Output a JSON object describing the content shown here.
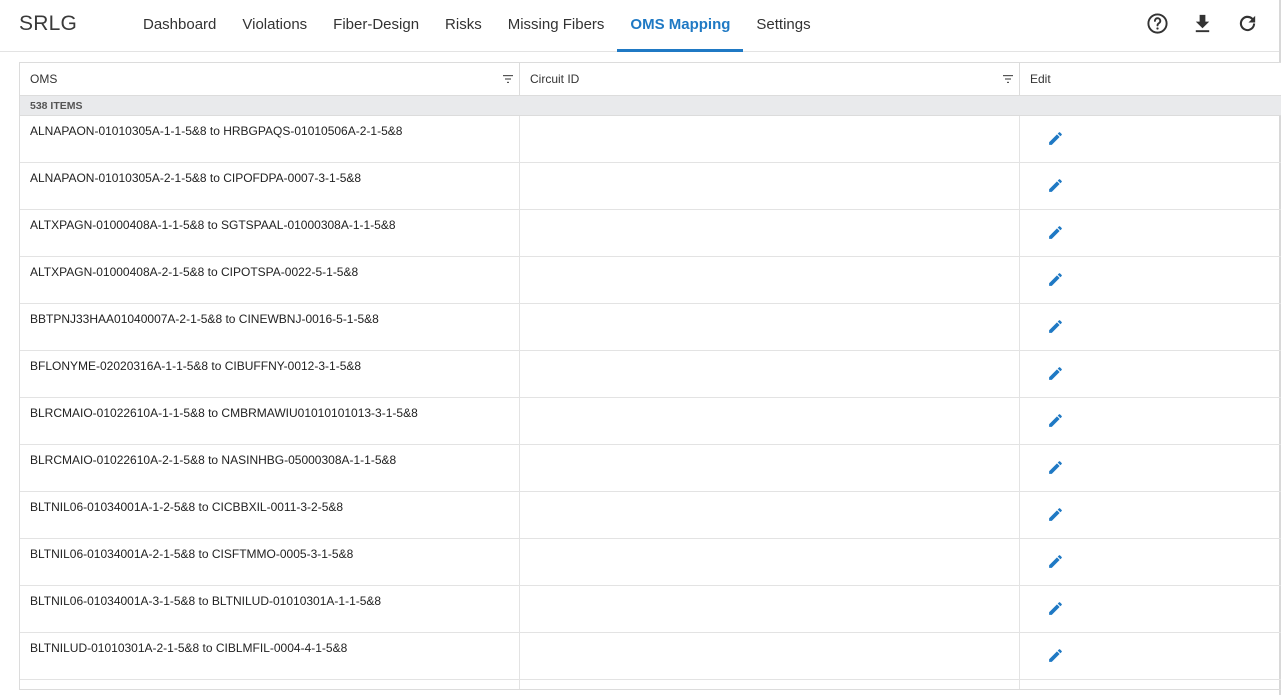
{
  "app": {
    "title": "SRLG"
  },
  "nav": {
    "tabs": [
      {
        "label": "Dashboard"
      },
      {
        "label": "Violations"
      },
      {
        "label": "Fiber-Design"
      },
      {
        "label": "Risks"
      },
      {
        "label": "Missing Fibers"
      },
      {
        "label": "OMS Mapping",
        "active": true
      },
      {
        "label": "Settings"
      }
    ]
  },
  "toolbar": {
    "icons": [
      "help-icon",
      "download-icon",
      "refresh-icon"
    ]
  },
  "grid": {
    "columns": [
      "OMS",
      "Circuit ID",
      "Edit"
    ],
    "group_label": "538 ITEMS",
    "rows": [
      {
        "oms": "ALNAPAON-01010305A-1-1-5&8 to HRBGPAQS-01010506A-2-1-5&8",
        "circuit": ""
      },
      {
        "oms": "ALNAPAON-01010305A-2-1-5&8 to CIPOFDPA-0007-3-1-5&8",
        "circuit": ""
      },
      {
        "oms": "ALTXPAGN-01000408A-1-1-5&8 to SGTSPAAL-01000308A-1-1-5&8",
        "circuit": ""
      },
      {
        "oms": "ALTXPAGN-01000408A-2-1-5&8 to CIPOTSPA-0022-5-1-5&8",
        "circuit": ""
      },
      {
        "oms": "BBTPNJ33HAA01040007A-2-1-5&8 to CINEWBNJ-0016-5-1-5&8",
        "circuit": ""
      },
      {
        "oms": "BFLONYME-02020316A-1-1-5&8 to CIBUFFNY-0012-3-1-5&8",
        "circuit": ""
      },
      {
        "oms": "BLRCMAIO-01022610A-1-1-5&8 to CMBRMAWIU01010101013-3-1-5&8",
        "circuit": ""
      },
      {
        "oms": "BLRCMAIO-01022610A-2-1-5&8 to NASINHBG-05000308A-1-1-5&8",
        "circuit": ""
      },
      {
        "oms": "BLTNIL06-01034001A-1-2-5&8 to CICBBXIL-0011-3-2-5&8",
        "circuit": ""
      },
      {
        "oms": "BLTNIL06-01034001A-2-1-5&8 to CISFTMMO-0005-3-1-5&8",
        "circuit": ""
      },
      {
        "oms": "BLTNIL06-01034001A-3-1-5&8 to BLTNILUD-01010301A-1-1-5&8",
        "circuit": ""
      },
      {
        "oms": "BLTNILUD-01010301A-2-1-5&8 to CIBLMFIL-0004-4-1-5&8",
        "circuit": ""
      },
      {
        "oms": "",
        "circuit": ""
      }
    ]
  },
  "colors": {
    "accent": "#1f79c4",
    "edit_icon": "#1f79c4"
  }
}
